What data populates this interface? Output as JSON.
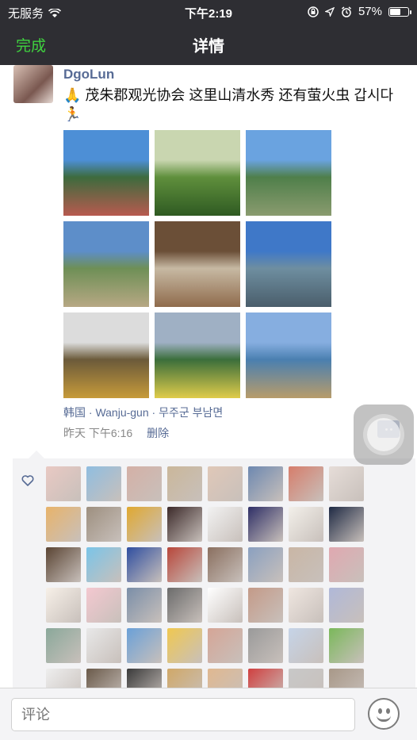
{
  "status_bar": {
    "carrier": "无服务",
    "wifi_icon": "wifi-icon",
    "time": "下午2:19",
    "battery_percent": "57%",
    "battery_level": 0.57
  },
  "nav": {
    "back_label": "完成",
    "title": "详情"
  },
  "post": {
    "author": "DgoLun",
    "text": "🙏 茂朱郡观光协会  这里山清水秀 还有萤火虫 갑시다🏃",
    "photos": [
      {
        "c1": "#4d8fd6",
        "c2": "#3d6b3d",
        "c3": "#b85a4f"
      },
      {
        "c1": "#c9d6b0",
        "c2": "#5f8f3c",
        "c3": "#2f5a22"
      },
      {
        "c1": "#6aa3e0",
        "c2": "#4f7f4a",
        "c3": "#8a9b6f"
      },
      {
        "c1": "#5d8ec9",
        "c2": "#6e8f56",
        "c3": "#b7a884"
      },
      {
        "c1": "#6b4f37",
        "c2": "#c7b9a3",
        "c3": "#8f6b4c"
      },
      {
        "c1": "#3f78c8",
        "c2": "#6e8ea0",
        "c3": "#4a5e6b"
      },
      {
        "c1": "#dcdcdc",
        "c2": "#6b5a3a",
        "c3": "#c79b3a"
      },
      {
        "c1": "#9fb0c4",
        "c2": "#3b6e3b",
        "c3": "#e0cc4a"
      },
      {
        "c1": "#86aee0",
        "c2": "#4a7fb0",
        "c3": "#b89c6a"
      }
    ],
    "location": "韩国 · Wanju-gun · 무주군 부남면",
    "time": "昨天 下午6:16",
    "delete_label": "删除"
  },
  "likers": [
    "#e9c9c3",
    "#8fbde0",
    "#d4b0a6",
    "#cab79a",
    "#e0c8b8",
    "#6d88b0",
    "#d67d6b",
    "#e6ddd8",
    "#e8b36a",
    "#9d8f7f",
    "#e0a830",
    "#3c2a2a",
    "#f2f2f2",
    "#2f2f66",
    "#f3f0ea",
    "#1f2a44",
    "#5a4433",
    "#7ac4e8",
    "#2f4ea0",
    "#b8463a",
    "#8a6f5f",
    "#8aa0c0",
    "#c9b6a5",
    "#e0a8b0",
    "#f7f0e8",
    "#f4c8d0",
    "#7a8ea8",
    "#6b6b6b",
    "#ffffff",
    "#c49a88",
    "#efe6e0",
    "#b0b8d8",
    "#8aa89a",
    "#e8e8e8",
    "#6aa0d8",
    "#f0c850",
    "#d5a596",
    "#9a9a9a",
    "#c6d4e8",
    "#7ab85a",
    "#eeeeee",
    "#6a5a4a",
    "#3a3a3a",
    "#d0a868",
    "#e0b890",
    "#d04040",
    "#c8c8c8",
    "#a89888"
  ],
  "comment_input": {
    "placeholder": "评论"
  }
}
